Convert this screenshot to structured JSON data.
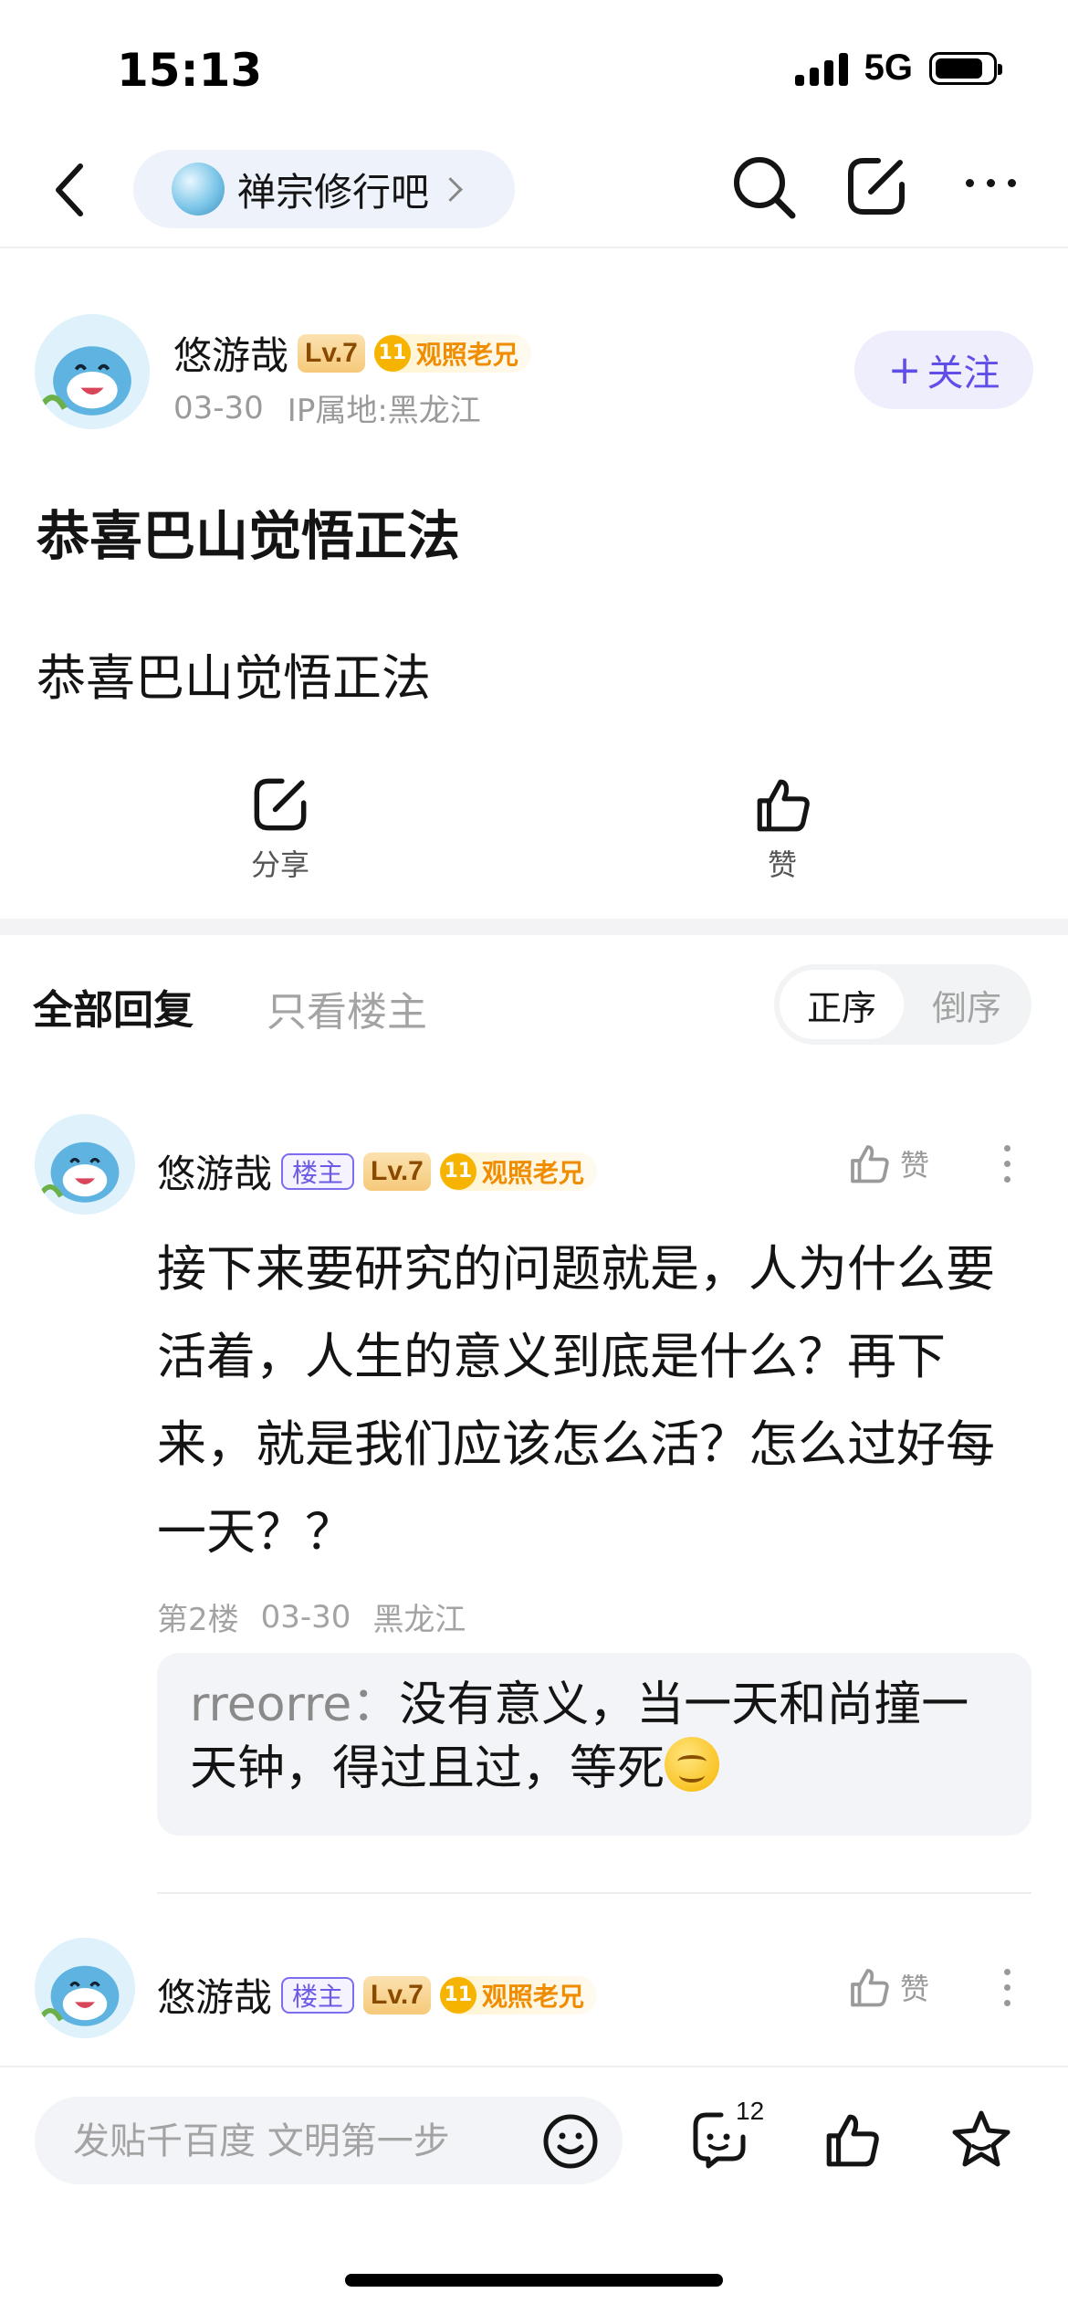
{
  "status_bar": {
    "time": "15:13",
    "network": "5G",
    "battery_level": 0.85
  },
  "nav": {
    "forum_name": "禅宗修行吧"
  },
  "post": {
    "author": "悠游哉",
    "level": "Lv.7",
    "title_level": "11",
    "title_badge": "观照老兄",
    "date": "03-30",
    "ip": "IP属地:黑龙江",
    "follow_label": "关注",
    "title": "恭喜巴山觉悟正法",
    "body": "恭喜巴山觉悟正法",
    "share_label": "分享",
    "like_label": "赞"
  },
  "replies_header": {
    "tab_all": "全部回复",
    "tab_owner": "只看楼主",
    "sort_asc": "正序",
    "sort_desc": "倒序"
  },
  "replies": [
    {
      "author": "悠游哉",
      "owner_badge": "楼主",
      "level": "Lv.7",
      "title_level": "11",
      "title_badge": "观照老兄",
      "like_label": "赞",
      "body": "接下来要研究的问题就是，人为什么要活着，人生的意义到底是什么？再下来，就是我们应该怎么活？怎么过好每一天？？",
      "floor": "第2楼",
      "date": "03-30",
      "location": "黑龙江",
      "sub_reply": {
        "user": "rreorre",
        "separator": "：",
        "text": "没有意义，当一天和尚撞一天钟，得过且过，等死"
      }
    },
    {
      "author": "悠游哉",
      "owner_badge": "楼主",
      "level": "Lv.7",
      "title_level": "11",
      "title_badge": "观照老兄",
      "like_label": "赞"
    }
  ],
  "bottom_bar": {
    "input_placeholder": "发贴千百度 文明第一步",
    "comment_count": "12"
  }
}
